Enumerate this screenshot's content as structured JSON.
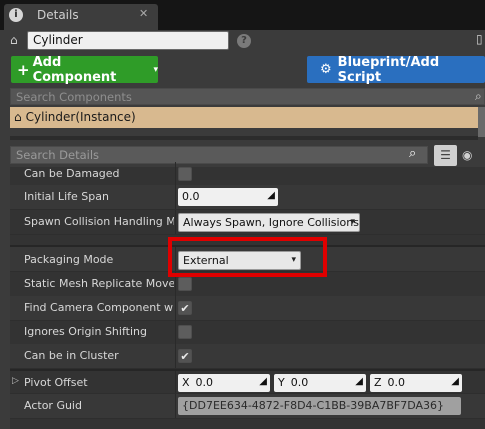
{
  "tab": {
    "icon": "info-icon",
    "title": "Details",
    "close": "✕"
  },
  "actor": {
    "icon": "actor-icon",
    "name": "Cylinder",
    "help": "?",
    "lock": "🔒"
  },
  "toolbar": {
    "add_component_label": "Add Component",
    "add_component_plus": "+",
    "add_component_caret": "▾",
    "blueprint_label": "Blueprint/Add Script",
    "blueprint_icon": "⚙"
  },
  "components": {
    "search_placeholder": "Search Components",
    "items": [
      {
        "label": "Cylinder(Instance)"
      }
    ]
  },
  "details": {
    "search_placeholder": "Search Details",
    "properties": [
      {
        "label": "Can be Damaged",
        "type": "checkbox",
        "checked": false
      },
      {
        "label": "Initial Life Span",
        "type": "number",
        "value": "0.0"
      },
      {
        "label": "Spawn Collision Handling Met",
        "type": "dropdown",
        "value": "Always Spawn, Ignore Collisions"
      },
      {
        "label": "Packaging Mode",
        "type": "dropdown",
        "value": "External"
      },
      {
        "label": "Static Mesh Replicate Movem",
        "type": "checkbox",
        "checked": false
      },
      {
        "label": "Find Camera Component wher",
        "type": "checkbox",
        "checked": true
      },
      {
        "label": "Ignores Origin Shifting",
        "type": "checkbox",
        "checked": false
      },
      {
        "label": "Can be in Cluster",
        "type": "checkbox",
        "checked": true
      },
      {
        "label": "Pivot Offset",
        "type": "vector",
        "x": "0.0",
        "y": "0.0",
        "z": "0.0"
      },
      {
        "label": "Actor Guid",
        "type": "text",
        "value": "{DD7EE634-4872-F8D4-C1BB-39BA7BF7DA36}"
      }
    ]
  },
  "glyphs": {
    "check": "✔",
    "caret": "▾",
    "drag": "◢",
    "expander": "▷",
    "search": "⌕",
    "view": "☰",
    "eye": "👁"
  },
  "colors": {
    "highlight": "#e00000",
    "add_button": "#2f9c28",
    "blueprint_button": "#2a6fbf",
    "selected_component": "#d8b98f"
  }
}
